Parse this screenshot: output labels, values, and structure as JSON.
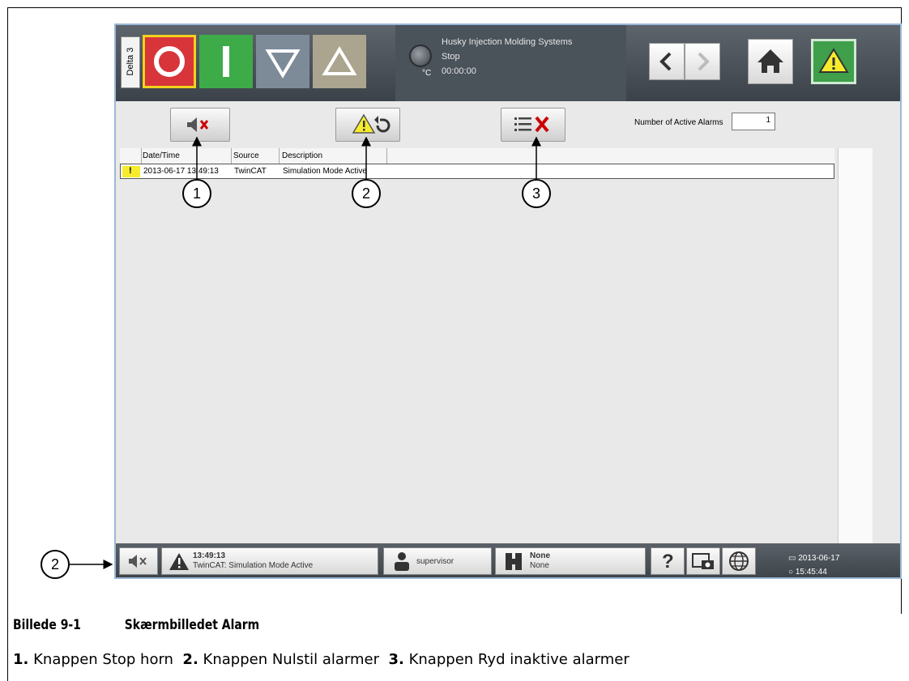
{
  "screen": {
    "delta_tab": "Delta 3",
    "temp_unit": "°C",
    "company": "Husky Injection Molding Systems",
    "state": "Stop",
    "timer": "00:00:00"
  },
  "alarm_page": {
    "count_label": "Number of Active Alarms",
    "count_value": "1",
    "columns": [
      "Date/Time",
      "Source",
      "Description"
    ],
    "rows": [
      {
        "flag": "!",
        "datetime": "2013-06-17 13:49:13",
        "source": "TwinCAT",
        "description": "Simulation Mode Active"
      }
    ]
  },
  "bottom_bar": {
    "alarm_time": "13:49:13",
    "alarm_text": "TwinCAT: Simulation Mode Active",
    "user": "supervisor",
    "mold_line1": "None",
    "mold_line2": "None",
    "help": "?",
    "date": "2013-06-17",
    "time": "15:45:44"
  },
  "callouts": {
    "c1": "1",
    "c2": "2",
    "c3": "3",
    "c2_left": "2"
  },
  "caption": {
    "figure_number": "Billede 9-1",
    "figure_title": "Skærmbilledet Alarm",
    "items": [
      {
        "num": "1.",
        "text": "Knappen Stop horn"
      },
      {
        "num": "2.",
        "text": "Knappen Nulstil alarmer"
      },
      {
        "num": "3.",
        "text": "Knappen Ryd inaktive alarmer"
      }
    ]
  },
  "colors": {
    "stop": "#d7353a",
    "start": "#3dab48",
    "alarm_yellow": "#f6ec2d",
    "frame_blue": "#9ab8d8"
  }
}
